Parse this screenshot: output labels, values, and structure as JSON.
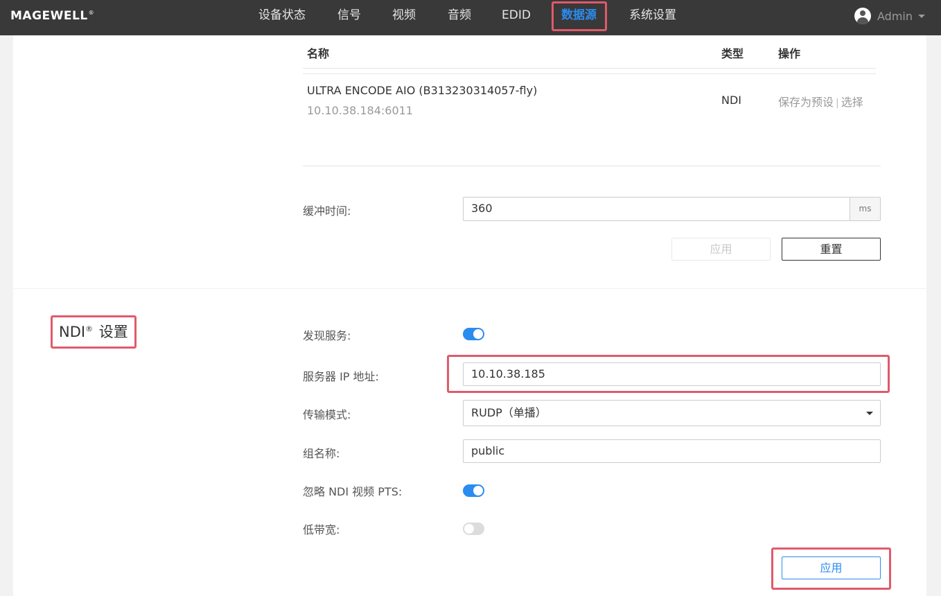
{
  "header": {
    "logo": "MAGEWELL",
    "logo_mark": "®",
    "nav": [
      {
        "label": "设备状态"
      },
      {
        "label": "信号"
      },
      {
        "label": "视频"
      },
      {
        "label": "音频"
      },
      {
        "label": "EDID"
      },
      {
        "label": "数据源",
        "active": true
      },
      {
        "label": "系统设置"
      }
    ],
    "user": {
      "name": "Admin"
    }
  },
  "sources": {
    "columns": {
      "name": "名称",
      "type": "类型",
      "actions": "操作"
    },
    "rows": [
      {
        "name": "ULTRA ENCODE AIO (B313230314057-fly)",
        "address": "10.10.38.184:6011",
        "type": "NDI",
        "action_save": "保存为预设",
        "action_sep": "|",
        "action_select": "选择"
      }
    ]
  },
  "buffer": {
    "label": "缓冲时间:",
    "value": "360",
    "unit": "ms",
    "apply_label": "应用",
    "reset_label": "重置"
  },
  "ndi": {
    "title_prefix": "NDI",
    "title_mark": "®",
    "title_suffix": " 设置",
    "discovery": {
      "label": "发现服务:",
      "enabled": true
    },
    "server_ip": {
      "label": "服务器 IP 地址:",
      "value": "10.10.38.185"
    },
    "transport": {
      "label": "传输模式:",
      "value": "RUDP（单播）"
    },
    "group": {
      "label": "组名称:",
      "value": "public"
    },
    "ignore_pts": {
      "label": "忽略 NDI 视频 PTS:",
      "enabled": true
    },
    "low_bandwidth": {
      "label": "低带宽:",
      "enabled": false
    },
    "apply_label": "应用"
  },
  "colors": {
    "accent": "#2a8cf0",
    "topbar": "#393939",
    "highlight": "#e05a6a"
  }
}
